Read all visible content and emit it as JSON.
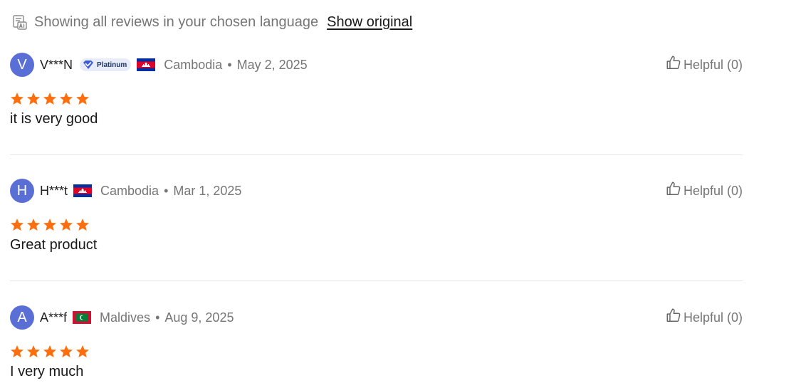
{
  "translation_bar": {
    "icon": "translate-ai-icon",
    "message": "Showing all reviews in your chosen language",
    "show_original_label": "Show original"
  },
  "colors": {
    "avatar": "#5a6fd6",
    "star": "#fd6f0e",
    "muted_text": "#767676"
  },
  "reviews": [
    {
      "avatar_letter": "V",
      "username": "V***N",
      "badge": "Platinum",
      "country": "Cambodia",
      "flag": "cambodia-flag-icon",
      "separator": "•",
      "date": "May 2, 2025",
      "rating": 5,
      "text": "it is very good",
      "helpful_label": "Helpful (0)"
    },
    {
      "avatar_letter": "H",
      "username": "H***t",
      "country": "Cambodia",
      "flag": "cambodia-flag-icon",
      "separator": "•",
      "date": "Mar 1, 2025",
      "rating": 5,
      "text": "Great product",
      "helpful_label": "Helpful (0)"
    },
    {
      "avatar_letter": "A",
      "username": "A***f",
      "country": "Maldives",
      "flag": "maldives-flag-icon",
      "separator": "•",
      "date": "Aug 9, 2025",
      "rating": 5,
      "text": "I very much",
      "helpful_label": "Helpful (0)"
    }
  ]
}
